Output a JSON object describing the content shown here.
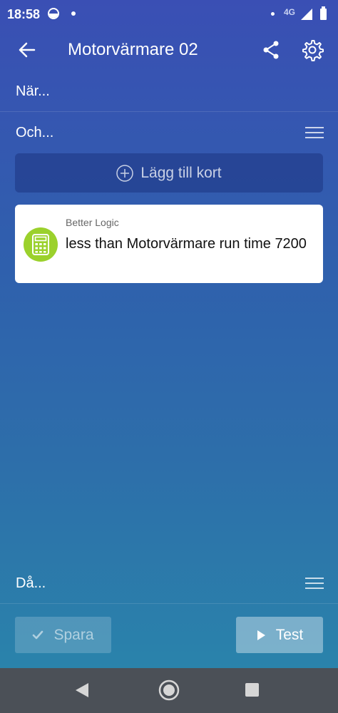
{
  "status_bar": {
    "time": "18:58",
    "network": "4G"
  },
  "app_bar": {
    "title": "Motorvärmare 02",
    "icons": [
      "arrow-back-icon",
      "share-icon",
      "gear-icon"
    ]
  },
  "sections": {
    "when_label": "När...",
    "and_label": "Och...",
    "then_label": "Då..."
  },
  "add_card": {
    "label": "Lägg till kort",
    "icon": "plus-circle-icon"
  },
  "cards": [
    {
      "source": "Better Logic",
      "text": "less than Motorvärmare run time 7200",
      "icon": "calculator-icon",
      "icon_color": "#9bd12c"
    }
  ],
  "actions": {
    "save_label": "Spara",
    "test_label": "Test"
  },
  "colors": {
    "accent_card_icon": "#9bd12c",
    "navbar": "#4b5057"
  }
}
